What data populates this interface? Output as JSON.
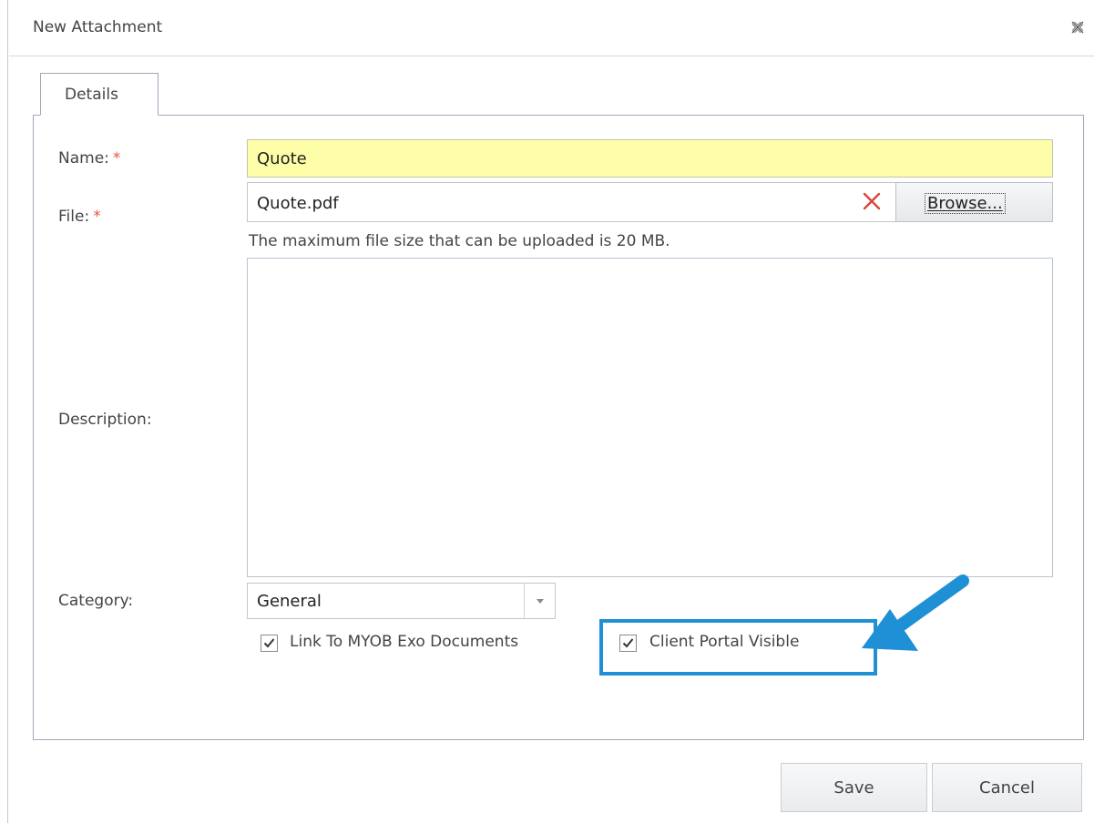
{
  "dialog": {
    "title": "New Attachment"
  },
  "tabs": [
    {
      "label": "Details"
    }
  ],
  "form": {
    "name": {
      "label": "Name:",
      "required": "*",
      "value": "Quote"
    },
    "file": {
      "label": "File:",
      "required": "*",
      "value": "Quote.pdf",
      "browse_label": "Browse...",
      "hint": "The maximum file size that can be uploaded is 20 MB."
    },
    "description": {
      "label": "Description:",
      "value": ""
    },
    "category": {
      "label": "Category:",
      "value": "General"
    },
    "checkboxes": [
      {
        "label": "Link To MYOB Exo Documents",
        "checked": true
      },
      {
        "label": "Client Portal Visible",
        "checked": true
      }
    ]
  },
  "buttons": {
    "save": "Save",
    "cancel": "Cancel"
  },
  "colors": {
    "highlight": "#1f90d6",
    "name_field_bg": "#fffea8",
    "required": "#e0593b",
    "clear_icon": "#d9473b"
  },
  "icons": {
    "close": "close-icon",
    "clear": "clear-x-icon",
    "dropdown": "chevron-down-icon",
    "annotation": "arrow-annotation-icon"
  }
}
